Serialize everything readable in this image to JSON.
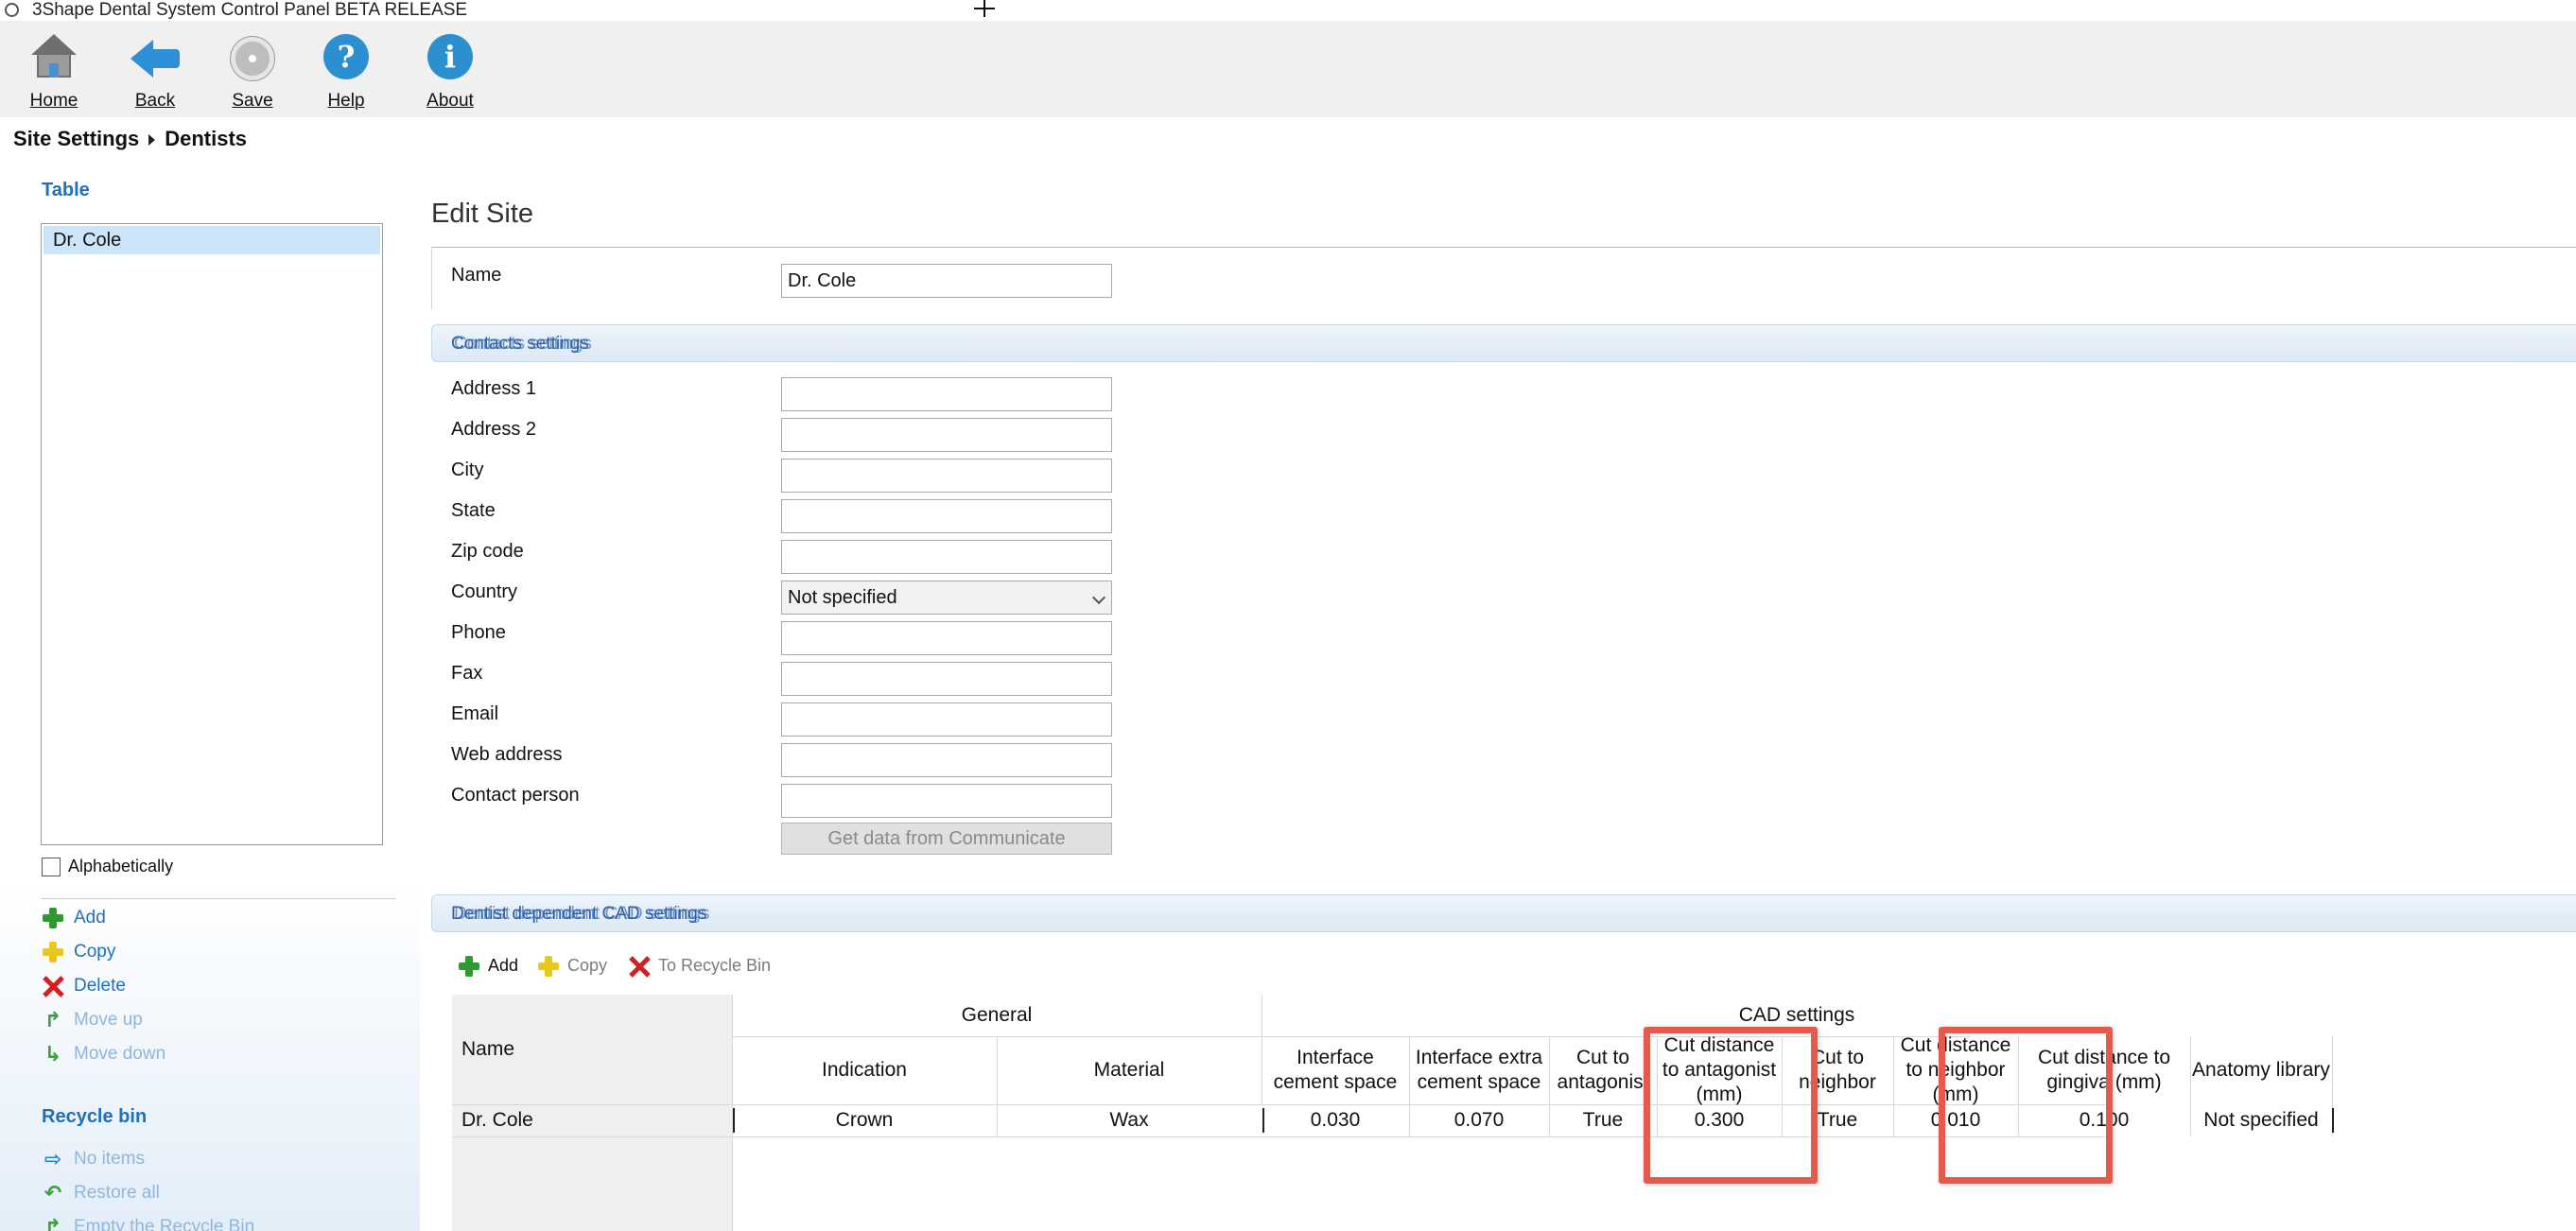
{
  "window": {
    "title": "3Shape Dental System Control Panel BETA RELEASE"
  },
  "toolbar": {
    "items": [
      {
        "label": "Home",
        "icon": "home-icon"
      },
      {
        "label": "Back",
        "icon": "back-arrow-icon"
      },
      {
        "label": "Save",
        "icon": "save-disc-icon"
      },
      {
        "label": "Help",
        "icon": "help-icon"
      },
      {
        "label": "About",
        "icon": "info-icon"
      }
    ]
  },
  "breadcrumb": {
    "parent": "Site Settings",
    "current": "Dentists"
  },
  "sidebar": {
    "table_title": "Table",
    "items": [
      "Dr. Cole"
    ],
    "alphabetically_label": "Alphabetically",
    "alphabetically_checked": false,
    "actions": {
      "add": "Add",
      "copy": "Copy",
      "delete": "Delete",
      "move_up": "Move up",
      "move_down": "Move down"
    },
    "recycle_title": "Recycle bin",
    "recycle_actions": {
      "no_items": "No items",
      "restore_all": "Restore all",
      "empty": "Empty the Recycle Bin"
    }
  },
  "edit_site": {
    "title": "Edit Site",
    "name_label": "Name",
    "name_value": "Dr. Cole",
    "contacts_section": "Contacts settings",
    "fields": {
      "address1": {
        "label": "Address 1",
        "value": ""
      },
      "address2": {
        "label": "Address 2",
        "value": ""
      },
      "city": {
        "label": "City",
        "value": ""
      },
      "state": {
        "label": "State",
        "value": ""
      },
      "zip": {
        "label": "Zip code",
        "value": ""
      },
      "country": {
        "label": "Country",
        "value": "Not specified"
      },
      "phone": {
        "label": "Phone",
        "value": ""
      },
      "fax": {
        "label": "Fax",
        "value": ""
      },
      "email": {
        "label": "Email",
        "value": ""
      },
      "web": {
        "label": "Web address",
        "value": ""
      },
      "contact_person": {
        "label": "Contact person",
        "value": ""
      }
    },
    "get_data_button": "Get data from Communicate",
    "cad_section": "Dentist dependent CAD settings"
  },
  "cad_toolbar": {
    "add": "Add",
    "copy": "Copy",
    "recycle": "To Recycle Bin"
  },
  "cad_grid": {
    "group_general": "General",
    "group_cad": "CAD settings",
    "columns": {
      "name": "Name",
      "indication": "Indication",
      "material": "Material",
      "interface_cement": "Interface cement space",
      "interface_extra": "Interface extra cement space",
      "cut_antagonist": "Cut to antagonist",
      "cut_dist_antagonist": "Cut distance to antagonist (mm)",
      "cut_neighbor": "Cut to neighbor",
      "cut_dist_neighbor": "Cut distance to neighbor (mm)",
      "cut_dist_gingiva": "Cut distance to gingiva (mm)",
      "anatomy_library": "Anatomy library"
    },
    "rows": [
      {
        "name": "Dr. Cole",
        "indication": "Crown",
        "material": "Wax",
        "interface_cement": "0.030",
        "interface_extra": "0.070",
        "cut_antagonist": "True",
        "cut_dist_antagonist": "0.300",
        "cut_neighbor": "True",
        "cut_dist_neighbor": "0.010",
        "cut_dist_gingiva": "0.100",
        "anatomy_library": "Not specified"
      }
    ]
  },
  "highlight_color": "#e55a4c"
}
